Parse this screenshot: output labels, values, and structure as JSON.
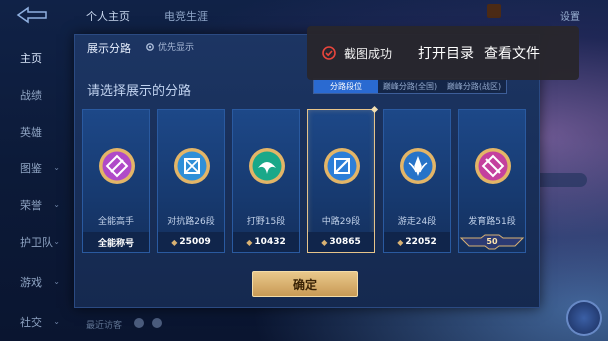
{
  "background": {
    "top_tabs": [
      "个人主页",
      "电竞生涯"
    ],
    "settings_label": "设置",
    "sidebar": [
      {
        "label": "主页",
        "active": true,
        "chevron": false
      },
      {
        "label": "战绩",
        "active": false,
        "chevron": false
      },
      {
        "label": "英雄",
        "active": false,
        "chevron": false
      },
      {
        "label": "图鉴",
        "active": false,
        "chevron": true
      },
      {
        "label": "荣誉",
        "active": false,
        "chevron": true
      },
      {
        "label": "护卫队",
        "active": false,
        "chevron": true
      },
      {
        "label": "游戏",
        "active": false,
        "chevron": true
      },
      {
        "label": "社交",
        "active": false,
        "chevron": true
      }
    ],
    "footer_text": "最近访客"
  },
  "dialog": {
    "title": "展示分路",
    "priority_label": "优先显示",
    "section_title": "请选择展示的分路",
    "segments": [
      {
        "label": "分路段位",
        "active": true
      },
      {
        "label": "巅峰分路(全国)",
        "active": false
      },
      {
        "label": "巅峰分路(战区)",
        "active": false
      }
    ],
    "cards": [
      {
        "label": "全能高手",
        "bottom_text": "全能称号",
        "score": "",
        "badge": "",
        "color": "#b04ac8",
        "icon": "allround-icon",
        "selected": false
      },
      {
        "label": "对抗路26段",
        "bottom_text": "",
        "score": "25009",
        "badge": "",
        "color": "#2f8fd8",
        "icon": "clash-lane-icon",
        "selected": false
      },
      {
        "label": "打野15段",
        "bottom_text": "",
        "score": "10432",
        "badge": "",
        "color": "#1aa889",
        "icon": "jungle-icon",
        "selected": false
      },
      {
        "label": "中路29段",
        "bottom_text": "",
        "score": "30865",
        "badge": "",
        "color": "#2c7ed8",
        "icon": "mid-lane-icon",
        "selected": true
      },
      {
        "label": "游走24段",
        "bottom_text": "",
        "score": "22052",
        "badge": "",
        "color": "#2773c8",
        "icon": "roam-icon",
        "selected": false
      },
      {
        "label": "发育路51段",
        "bottom_text": "",
        "score": "",
        "badge": "50",
        "color": "#c4409e",
        "icon": "farm-lane-icon",
        "selected": false
      }
    ],
    "confirm_label": "确定"
  },
  "toast": {
    "message": "截图成功",
    "open_dir": "打开目录",
    "view_file": "查看文件",
    "icon": "check-circle-icon",
    "icon_color": "#e8453c"
  }
}
